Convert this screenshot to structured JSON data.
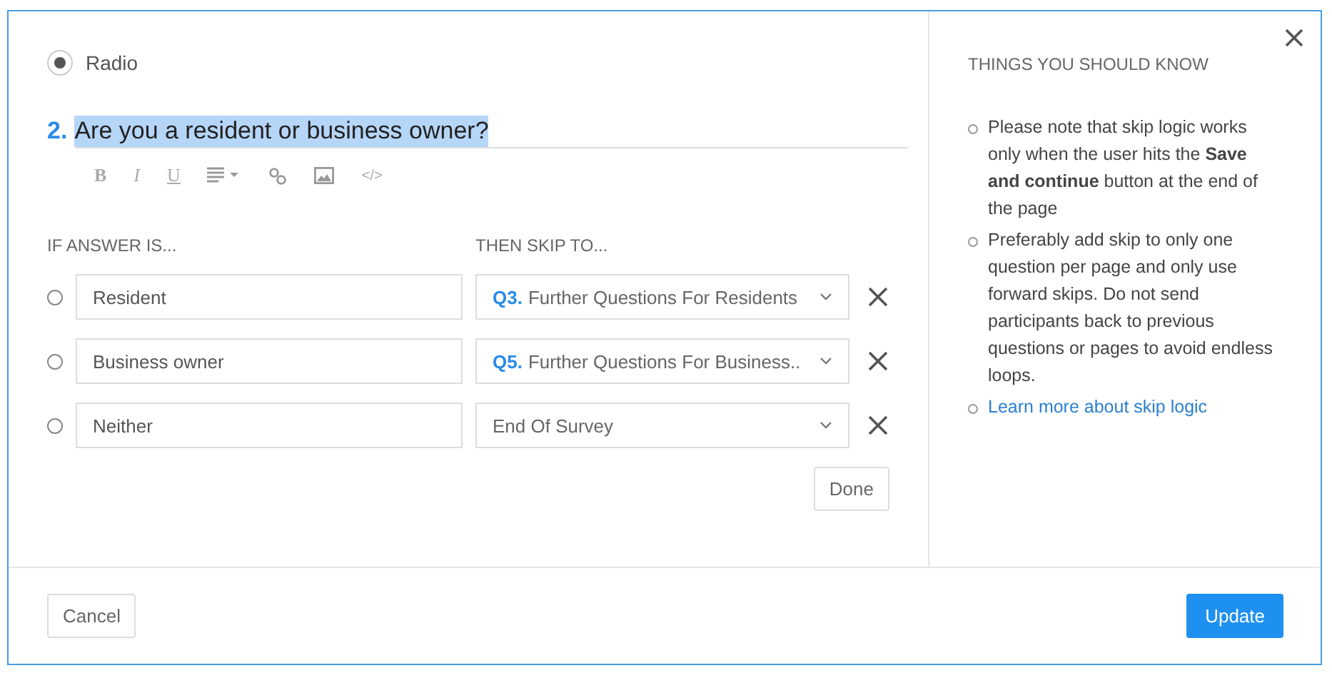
{
  "question_type": {
    "label": "Radio",
    "selected": true
  },
  "question": {
    "number": "2.",
    "text": "Are you a resident or business owner?",
    "highlighted": true
  },
  "toolbar": [
    {
      "kind": "bold",
      "label": "B"
    },
    {
      "kind": "italic",
      "label": "I"
    },
    {
      "kind": "underline",
      "label": "U"
    },
    {
      "kind": "align"
    },
    {
      "kind": "link"
    },
    {
      "kind": "image"
    },
    {
      "kind": "code",
      "label": "</>"
    }
  ],
  "columns": {
    "answer": "IF ANSWER IS...",
    "skip": "THEN SKIP TO..."
  },
  "rules": [
    {
      "answer": "Resident",
      "selected": false,
      "prefix": "Q3.",
      "target": "Further Questions For Residents"
    },
    {
      "answer": "Business owner",
      "selected": false,
      "prefix": "Q5.",
      "target": "Further Questions For Business.."
    },
    {
      "answer": "Neither",
      "selected": false,
      "target": "End Of Survey"
    }
  ],
  "done_button": "Done",
  "side": {
    "title": "THINGS YOU SHOULD KNOW",
    "items": [
      {
        "kind": "text",
        "text": "Please note that skip logic works only when the user hits the **Save and continue** button at the end of the page"
      },
      {
        "kind": "text",
        "text": "Preferably add skip to only one question per page and only use forward skips. Do not send participants back to previous questions or pages to avoid endless loops."
      },
      {
        "kind": "link",
        "text": "Learn more about skip logic"
      }
    ]
  },
  "footer": {
    "cancel": "Cancel",
    "update": "Update"
  }
}
